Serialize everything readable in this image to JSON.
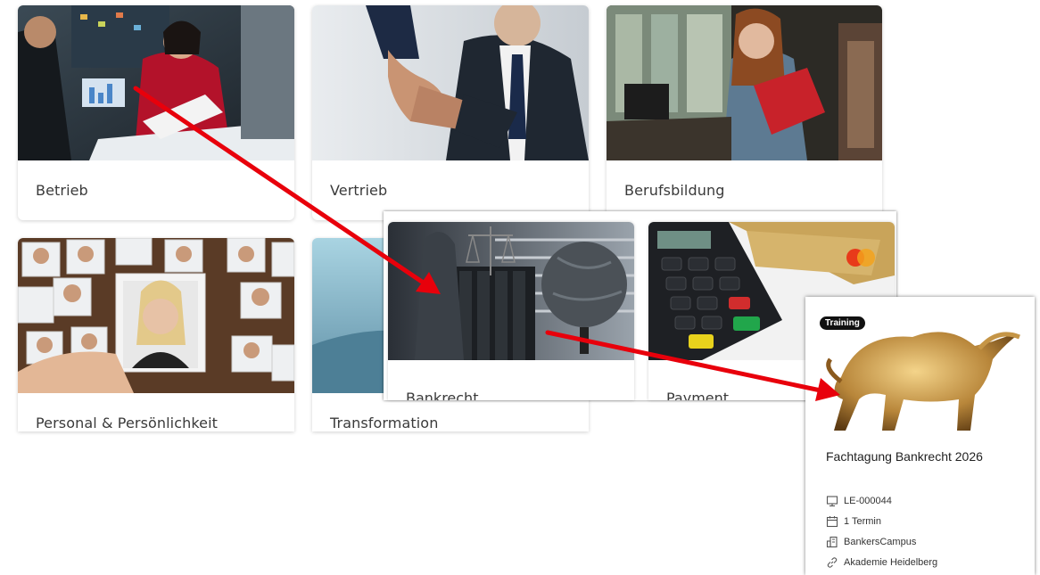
{
  "categories": [
    {
      "label": "Betrieb"
    },
    {
      "label": "Vertrieb"
    },
    {
      "label": "Berufsbildung"
    },
    {
      "label": "Personal & Persönlichkeit"
    },
    {
      "label": "Transformation"
    }
  ],
  "subcategories": [
    {
      "label": "Bankrecht"
    },
    {
      "label": "Payment"
    }
  ],
  "detail": {
    "badge": "Training",
    "title": "Fachtagung Bankrecht 2026",
    "meta": [
      {
        "icon": "monitor-icon",
        "text": "LE-000044"
      },
      {
        "icon": "calendar-icon",
        "text": "1 Termin"
      },
      {
        "icon": "building-icon",
        "text": "BankersCampus"
      },
      {
        "icon": "link-icon",
        "text": "Akademie Heidelberg"
      }
    ]
  },
  "colors": {
    "arrow": "#e8000b"
  }
}
